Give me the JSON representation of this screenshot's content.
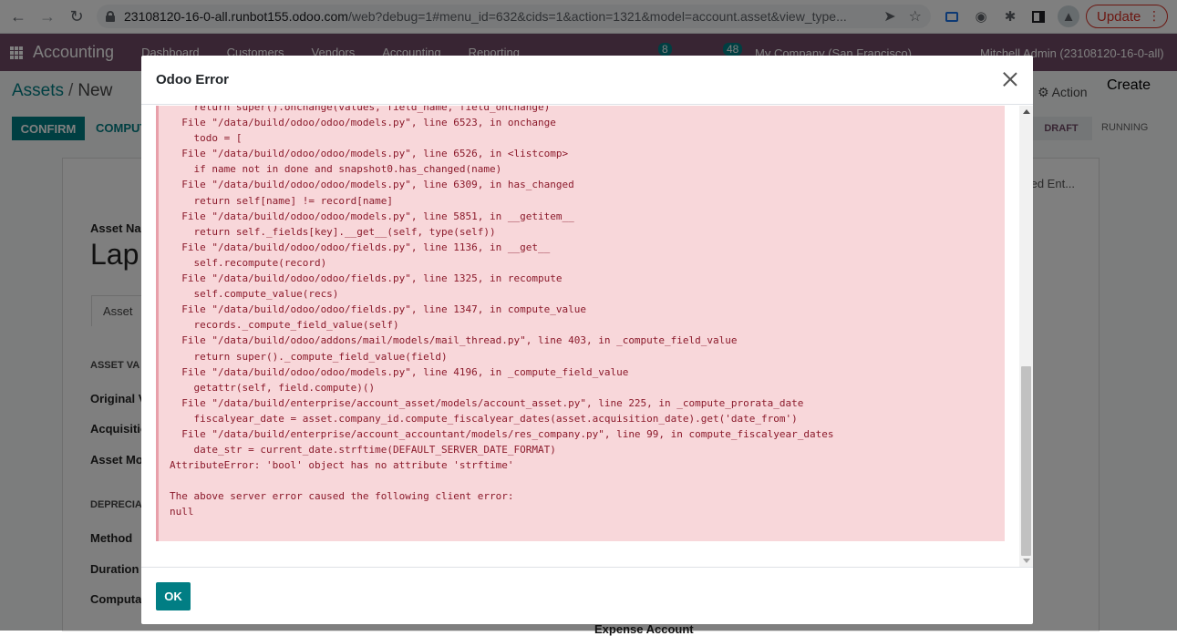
{
  "browser": {
    "url_host": "23108120-16-0-all.runbot155.odoo.com",
    "url_path": "/web?debug=1#menu_id=632&cids=1&action=1321&model=account.asset&view_type...",
    "update_label": "Update"
  },
  "odoo": {
    "app_name": "Accounting",
    "menu": [
      "Dashboard",
      "Customers",
      "Vendors",
      "Accounting",
      "Reporting"
    ],
    "company": "My Company (San Francisco)",
    "user": "Mitchell Admin (23108120-16-0-all)",
    "badge_messages": "8",
    "badge_activities": "48",
    "breadcrumb_parent": "Assets",
    "breadcrumb_current": "New",
    "action_label": "Action",
    "create_label": "Create",
    "confirm_label": "CONFIRM",
    "compute_label": "COMPUT",
    "status_draft": "DRAFT",
    "status_running": "RUNNING",
    "asset_name_label": "Asset Na",
    "asset_name_value": "Lap",
    "tab_asset": "Asset",
    "section_asset_values": "ASSET VA",
    "label_original": "Original V",
    "label_acquisition": "Acquisitio",
    "label_asset_model": "Asset Mo",
    "section_depreciation": "DEPRECIA",
    "label_method": "Method",
    "label_duration": "Duration",
    "label_computation": "Computa",
    "posted_entries": "ted Ent...",
    "expense_account": "Expense Account"
  },
  "dialog": {
    "title": "Odoo Error",
    "traceback": "    return super().onchange(values, field_name, field_onchange)\n  File \"/data/build/odoo/odoo/models.py\", line 6523, in onchange\n    todo = [\n  File \"/data/build/odoo/odoo/models.py\", line 6526, in <listcomp>\n    if name not in done and snapshot0.has_changed(name)\n  File \"/data/build/odoo/odoo/models.py\", line 6309, in has_changed\n    return self[name] != record[name]\n  File \"/data/build/odoo/odoo/models.py\", line 5851, in __getitem__\n    return self._fields[key].__get__(self, type(self))\n  File \"/data/build/odoo/odoo/fields.py\", line 1136, in __get__\n    self.recompute(record)\n  File \"/data/build/odoo/odoo/fields.py\", line 1325, in recompute\n    self.compute_value(recs)\n  File \"/data/build/odoo/odoo/fields.py\", line 1347, in compute_value\n    records._compute_field_value(self)\n  File \"/data/build/odoo/addons/mail/models/mail_thread.py\", line 403, in _compute_field_value\n    return super()._compute_field_value(field)\n  File \"/data/build/odoo/odoo/models.py\", line 4196, in _compute_field_value\n    getattr(self, field.compute)()\n  File \"/data/build/enterprise/account_asset/models/account_asset.py\", line 225, in _compute_prorata_date\n    fiscalyear_date = asset.company_id.compute_fiscalyear_dates(asset.acquisition_date).get('date_from')\n  File \"/data/build/enterprise/account_accountant/models/res_company.py\", line 99, in compute_fiscalyear_dates\n    date_str = current_date.strftime(DEFAULT_SERVER_DATE_FORMAT)\nAttributeError: 'bool' object has no attribute 'strftime'\n\nThe above server error caused the following client error:\nnull",
    "ok_label": "OK"
  },
  "colors": {
    "odoo_purple": "#714b67",
    "odoo_teal": "#017e84",
    "error_bg": "#f8d7da",
    "error_text": "#8b1a2b"
  }
}
